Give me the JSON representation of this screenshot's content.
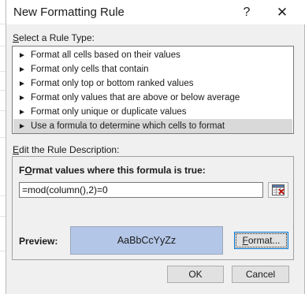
{
  "dialog": {
    "title": "New Formatting Rule",
    "help_glyph": "?",
    "close_glyph": "✕"
  },
  "rule_type": {
    "label_mnemonic": "S",
    "label_rest": "elect a Rule Type:",
    "arrow_glyph": "►",
    "items": [
      {
        "label": "Format all cells based on their values",
        "selected": false
      },
      {
        "label": "Format only cells that contain",
        "selected": false
      },
      {
        "label": "Format only top or bottom ranked values",
        "selected": false
      },
      {
        "label": "Format only values that are above or below average",
        "selected": false
      },
      {
        "label": "Format only unique or duplicate values",
        "selected": false
      },
      {
        "label": "Use a formula to determine which cells to format",
        "selected": true
      }
    ]
  },
  "description": {
    "label_mnemonic": "E",
    "label_rest": "dit the Rule Description:",
    "formula_header_mnemonic": "O",
    "formula_header_pre": "F",
    "formula_header_rest": "rmat values where this formula is true:",
    "formula_value": "=mod(column(),2)=0",
    "preview_label": "Preview:",
    "preview_text": "AaBbCcYyZz",
    "preview_fill": "#b4c6e7",
    "format_button_mnemonic": "F",
    "format_button_rest": "ormat..."
  },
  "buttons": {
    "ok": "OK",
    "cancel": "Cancel"
  },
  "colors": {
    "dialog_bg": "#f0f0f0",
    "selected_item_bg": "#d9d9d9",
    "focus_border": "#0078d7"
  }
}
